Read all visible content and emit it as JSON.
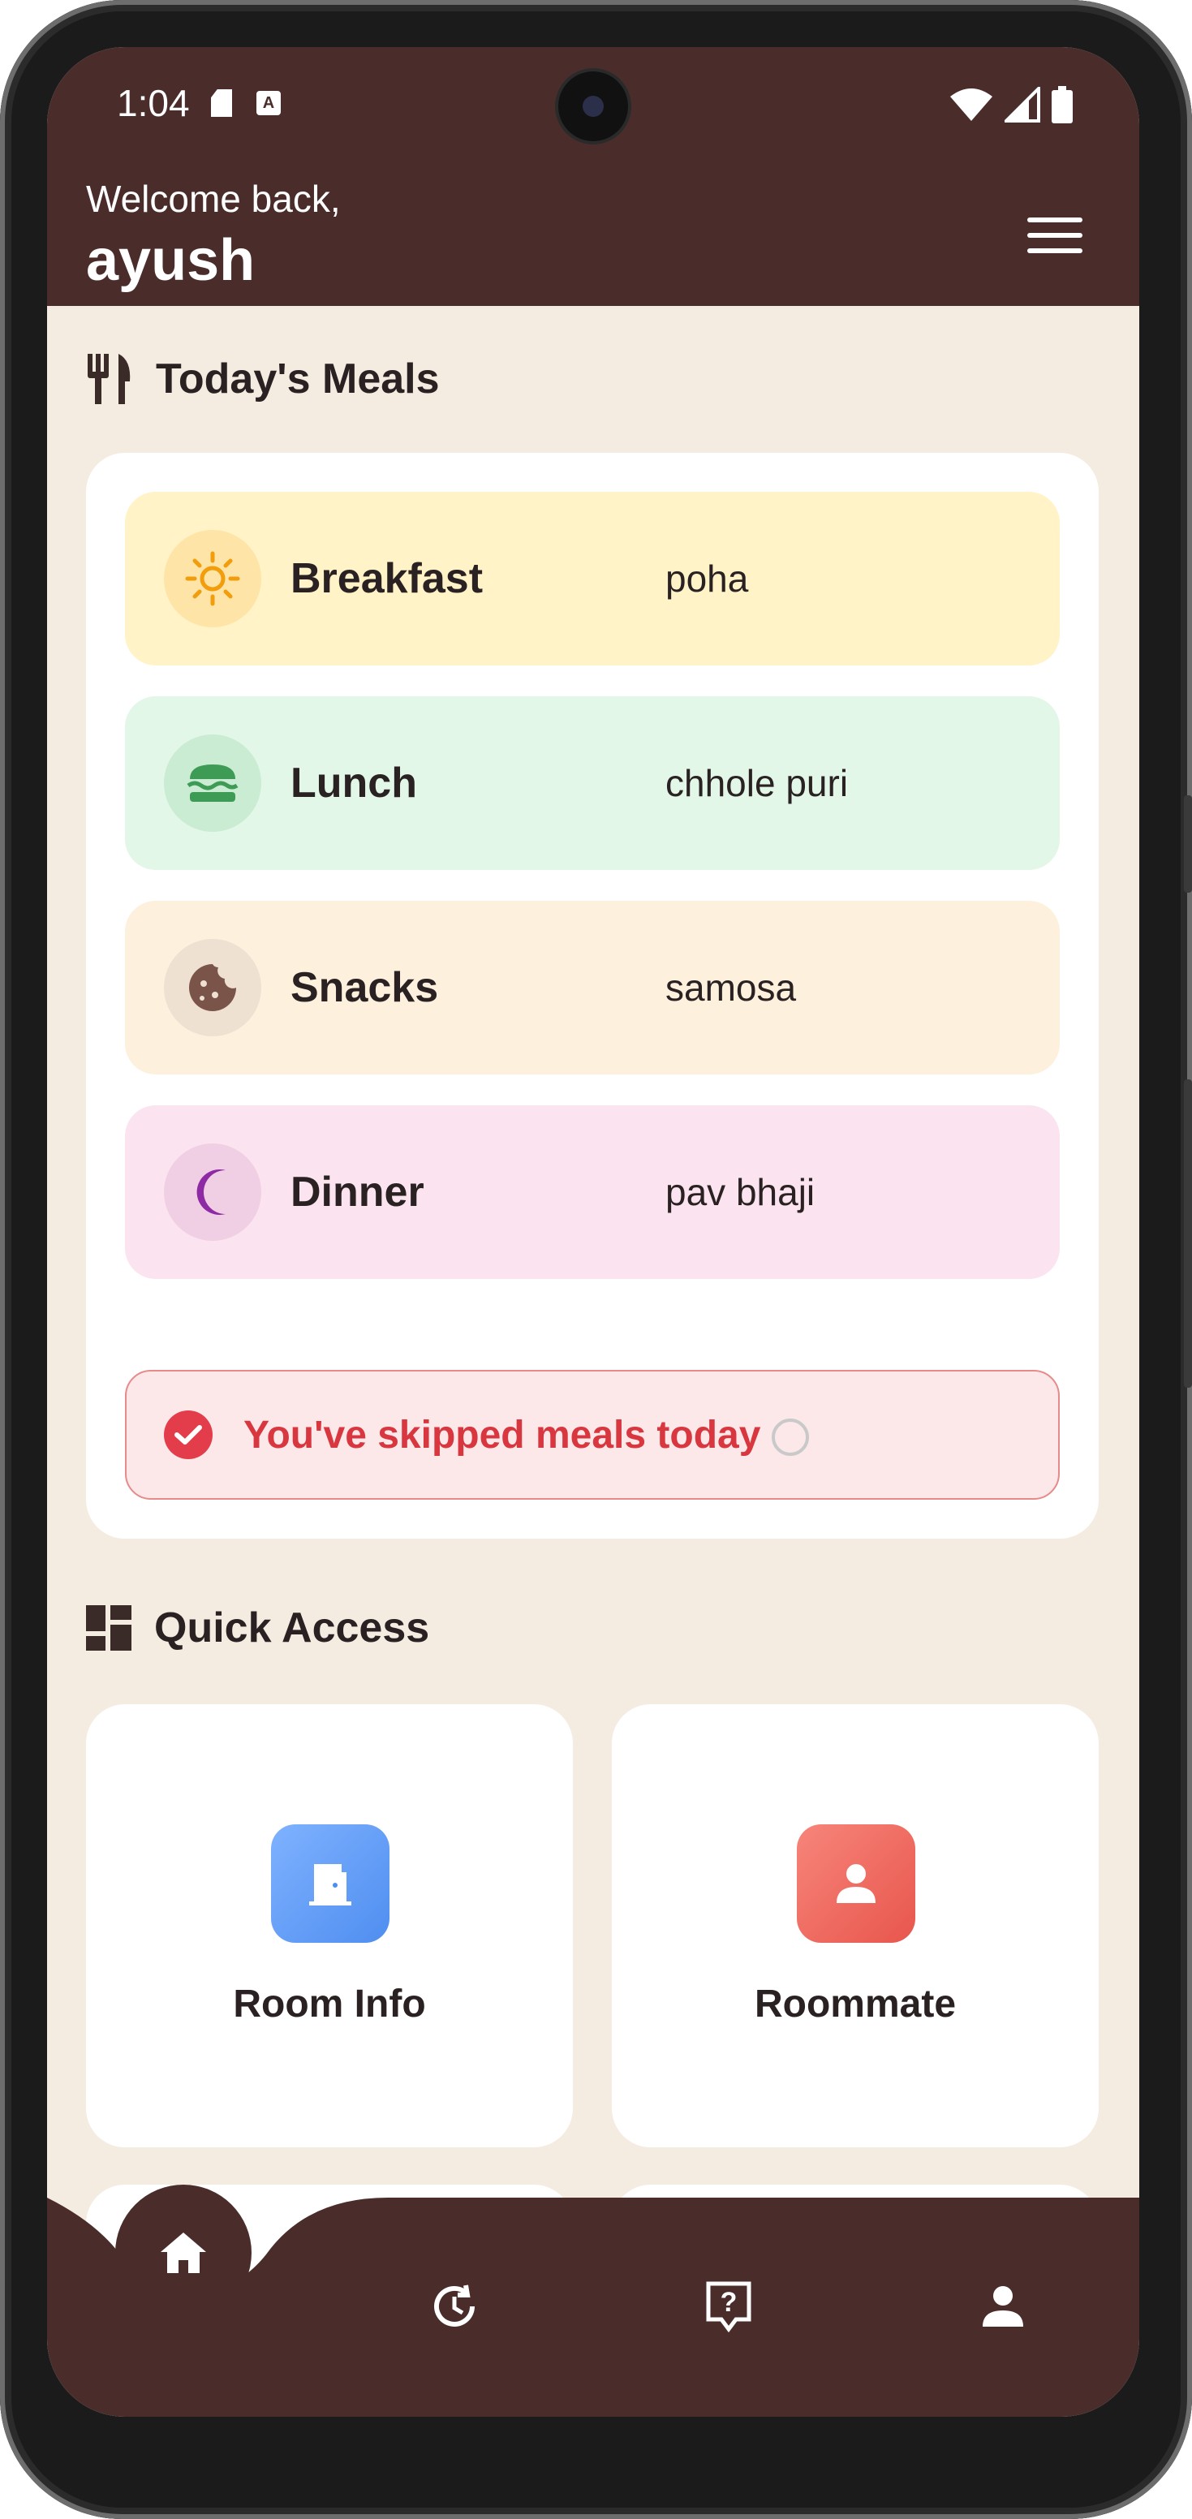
{
  "status_bar": {
    "time": "1:04"
  },
  "header": {
    "greeting": "Welcome back,",
    "username": "ayush"
  },
  "todays_meals": {
    "title": "Today's Meals",
    "meals": [
      {
        "name": "Breakfast",
        "item": "poha",
        "icon": "sun-icon",
        "bg": "#fff3c7",
        "icon_bg": "#ffe4a8",
        "icon_color": "#f29d0b"
      },
      {
        "name": "Lunch",
        "item": "chhole puri",
        "icon": "burger-icon",
        "bg": "#e2f7e8",
        "icon_bg": "#c9ecd3",
        "icon_color": "#3d9b55"
      },
      {
        "name": "Snacks",
        "item": "samosa",
        "icon": "cookie-icon",
        "bg": "#fdf0dd",
        "icon_bg": "#efe1d2",
        "icon_color": "#7a5448"
      },
      {
        "name": "Dinner",
        "item": "pav bhaji",
        "icon": "moon-icon",
        "bg": "#fbe4ef",
        "icon_bg": "#f0cfe5",
        "icon_color": "#8e2aa3"
      }
    ],
    "skip_notice": "You've skipped meals today"
  },
  "quick_access": {
    "title": "Quick Access",
    "tiles": [
      {
        "label": "Room Info",
        "icon": "door-icon",
        "color": "#5b9bf7"
      },
      {
        "label": "Roommate",
        "icon": "person-icon",
        "color": "#f06a5e"
      }
    ]
  },
  "bottom_nav": {
    "items": [
      "home-icon",
      "history-icon",
      "help-icon",
      "profile-icon"
    ],
    "active": "home-icon"
  },
  "colors": {
    "header_bg": "#4a2d2b",
    "page_bg": "#f4ece1",
    "alert": "#d8373f"
  }
}
